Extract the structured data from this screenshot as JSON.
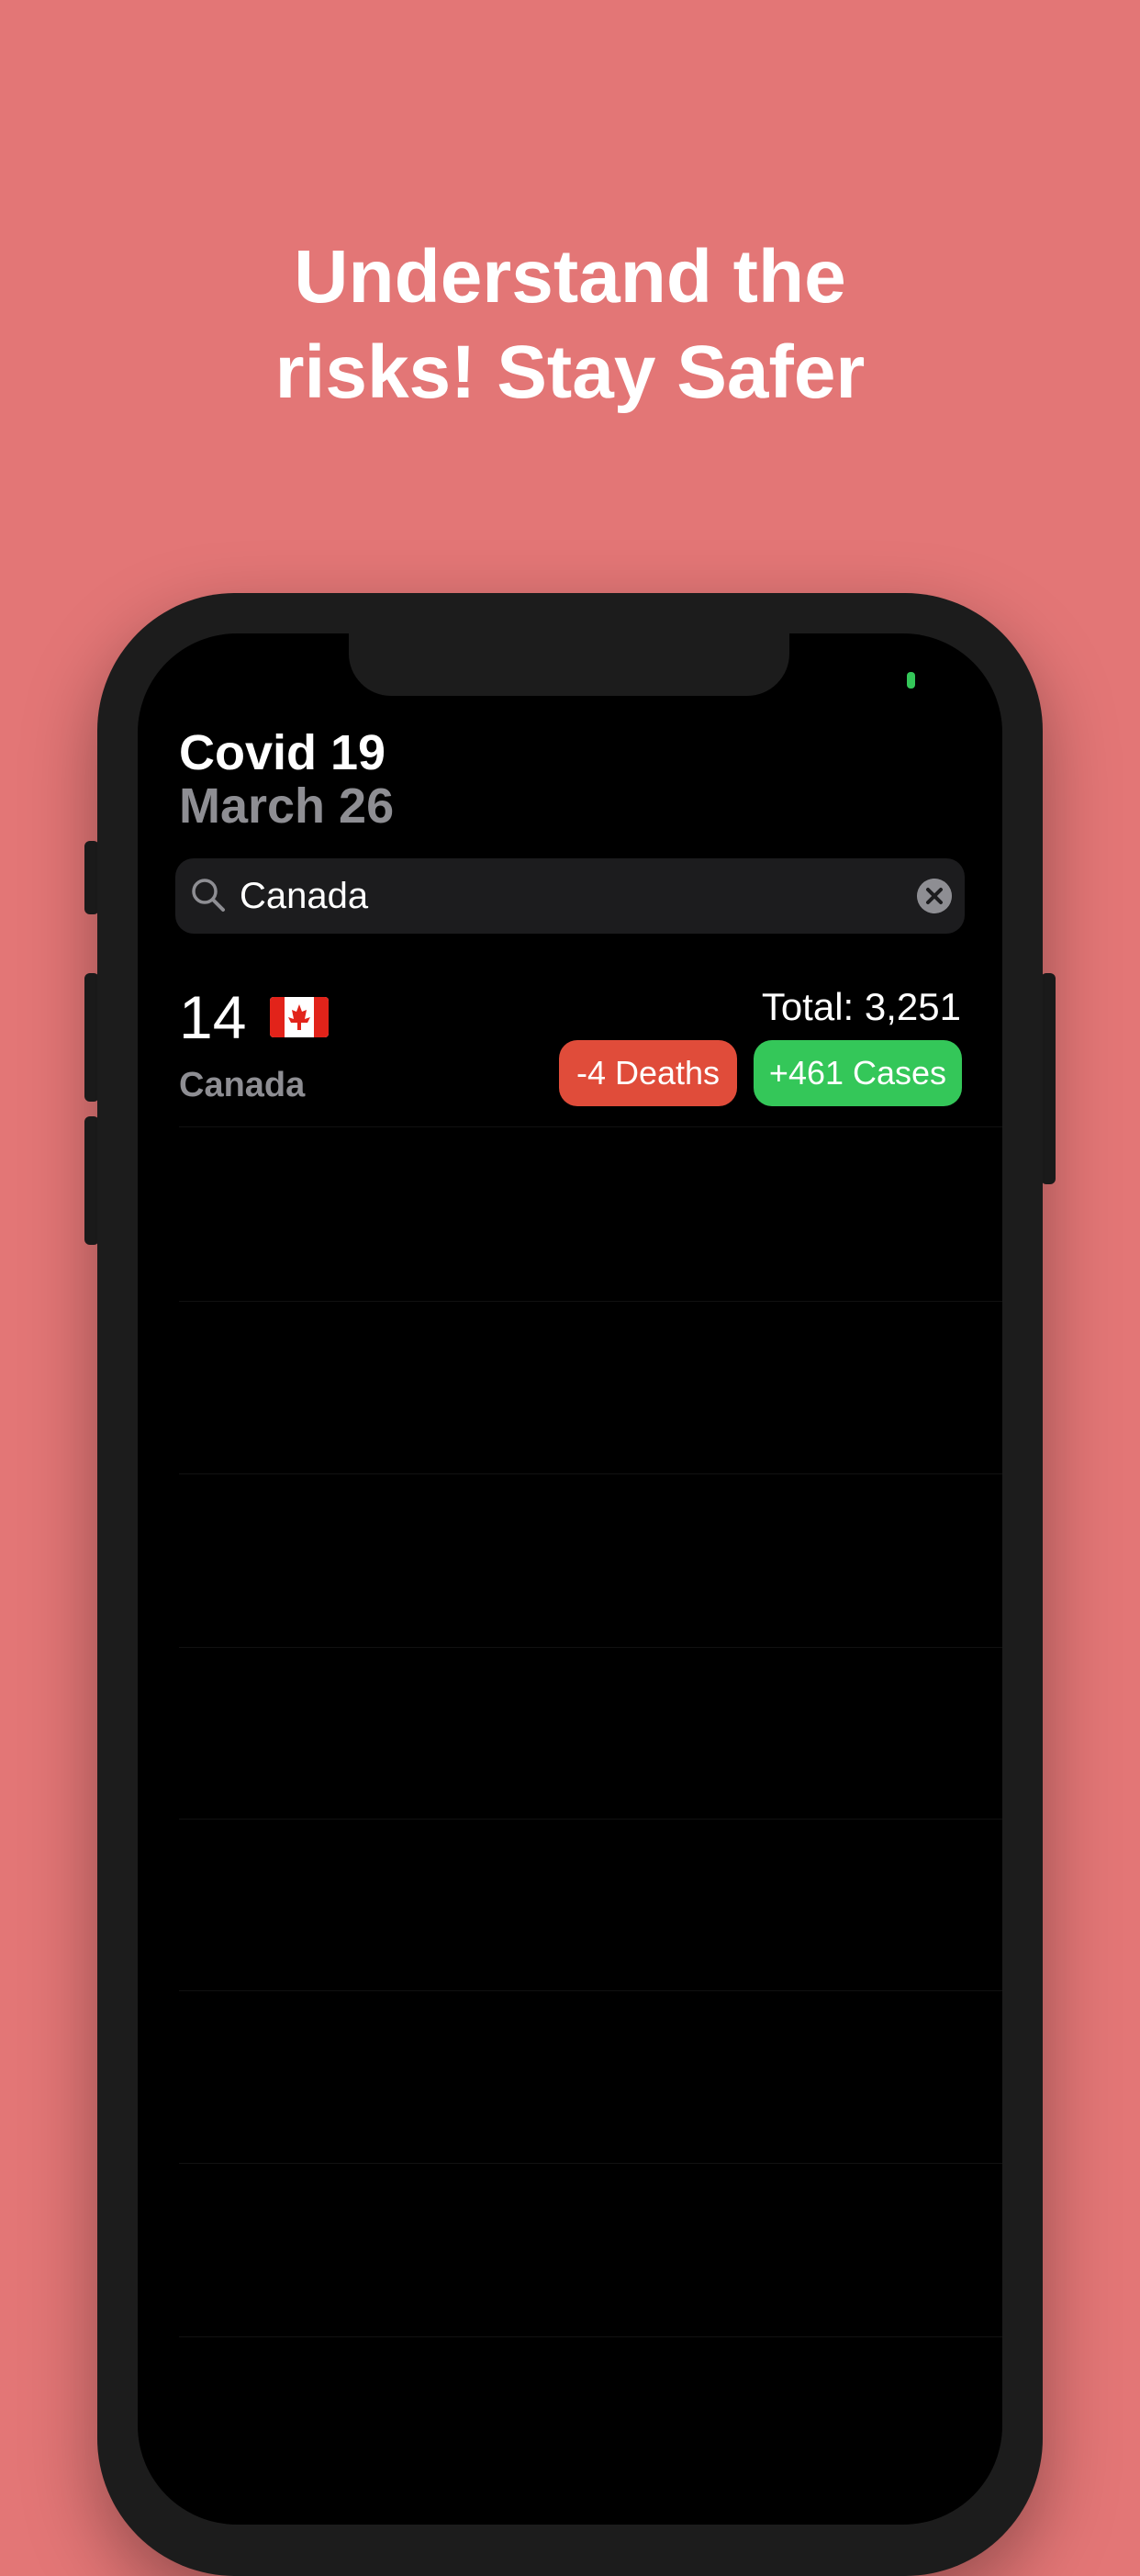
{
  "promo": {
    "headline_line1": "Understand the",
    "headline_line2": "risks! Stay Safer"
  },
  "app": {
    "title": "Covid 19",
    "date": "March 26"
  },
  "search": {
    "value": "Canada",
    "icon": "magnifying-glass",
    "clear_icon": "clear-x-circle"
  },
  "results": [
    {
      "rank": "14",
      "flag": "canada-flag",
      "country": "Canada",
      "total": "Total: 3,251",
      "deaths_badge": "-4 Deaths",
      "cases_badge": "+461 Cases"
    }
  ],
  "colors": {
    "background": "#E37676",
    "deaths": "#e04c3a",
    "cases": "#34c759"
  }
}
